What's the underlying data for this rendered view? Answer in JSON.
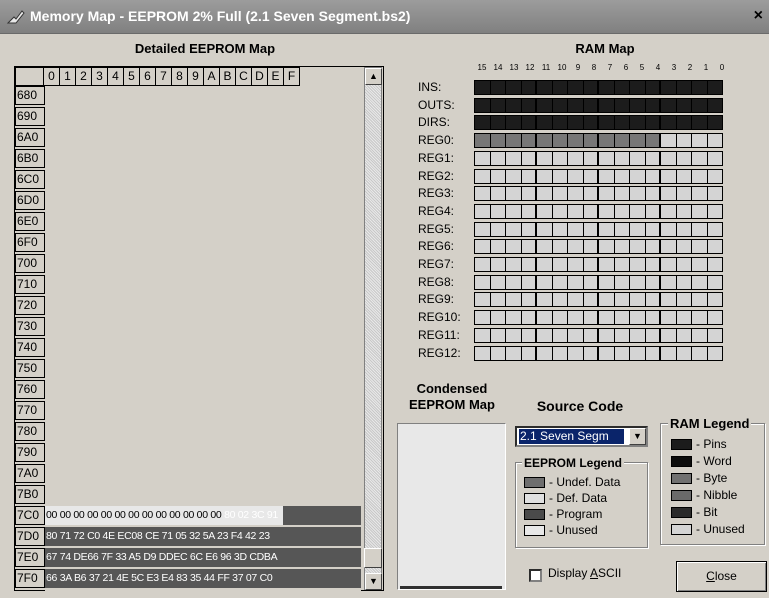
{
  "window": {
    "title": "Memory Map - EEPROM 2% Full (2.1 Seven Segment.bs2)",
    "close_glyph": "×"
  },
  "eeprom": {
    "heading": "Detailed EEPROM Map",
    "col_headers": [
      "0",
      "1",
      "2",
      "3",
      "4",
      "5",
      "6",
      "7",
      "8",
      "9",
      "A",
      "B",
      "C",
      "D",
      "E",
      "F"
    ],
    "row_headers": [
      "680",
      "690",
      "6A0",
      "6B0",
      "6C0",
      "6D0",
      "6E0",
      "6F0",
      "700",
      "710",
      "720",
      "730",
      "740",
      "750",
      "760",
      "770",
      "780",
      "790",
      "7A0",
      "7B0",
      "7C0",
      "7D0",
      "7E0",
      "7F0"
    ],
    "data_rows": [
      {
        "addr": "7C0",
        "text_light": "00 00 00 00 00 00 00 00 00 00 00 00 00 ",
        "text_dark": "80 02 3C 91"
      },
      {
        "addr": "7D0",
        "text_light": "",
        "text_dark": "80 71 72 C0 4E EC08 CE 71 05 32 5A 23 F4 42 23"
      },
      {
        "addr": "7E0",
        "text_light": "",
        "text_dark": "67 74 DE66 7F 33 A5 D9 DDEC 6C E6 96 3D CDBA"
      },
      {
        "addr": "7F0",
        "text_light": "",
        "text_dark": "66 3A B6 37 21 4E 5C E3 E4 83 35 44 FF 37 07 C0"
      }
    ]
  },
  "ram": {
    "heading": "RAM Map",
    "bit_numbers": [
      "15",
      "14",
      "13",
      "12",
      "11",
      "10",
      "9",
      "8",
      "7",
      "6",
      "5",
      "4",
      "3",
      "2",
      "1",
      "0"
    ],
    "registers": [
      {
        "label": "INS:",
        "type": "pins"
      },
      {
        "label": "OUTS:",
        "type": "pins"
      },
      {
        "label": "DIRS:",
        "type": "pins"
      },
      {
        "label": "REG0:",
        "type": "reg0"
      },
      {
        "label": "REG1:",
        "type": "unused"
      },
      {
        "label": "REG2:",
        "type": "unused"
      },
      {
        "label": "REG3:",
        "type": "unused"
      },
      {
        "label": "REG4:",
        "type": "unused"
      },
      {
        "label": "REG5:",
        "type": "unused"
      },
      {
        "label": "REG6:",
        "type": "unused"
      },
      {
        "label": "REG7:",
        "type": "unused"
      },
      {
        "label": "REG8:",
        "type": "unused"
      },
      {
        "label": "REG9:",
        "type": "unused"
      },
      {
        "label": "REG10:",
        "type": "unused"
      },
      {
        "label": "REG11:",
        "type": "unused"
      },
      {
        "label": "REG12:",
        "type": "unused"
      }
    ]
  },
  "condensed": {
    "heading_line1": "Condensed",
    "heading_line2": "EEPROM Map"
  },
  "source_code": {
    "heading": "Source Code",
    "selected": "2.1 Seven Segm"
  },
  "eeprom_legend": {
    "title": "EEPROM Legend",
    "items": [
      {
        "label": "- Undef. Data",
        "color": "#6e6e6e"
      },
      {
        "label": "- Def. Data",
        "color": "#e0e0e0"
      },
      {
        "label": "- Program",
        "color": "#4a4a4a"
      },
      {
        "label": "- Unused",
        "color": "#e8e8e8"
      }
    ]
  },
  "ram_legend": {
    "title": "RAM Legend",
    "items": [
      {
        "label": "- Pins",
        "color": "#1c1c1c"
      },
      {
        "label": "- Word",
        "color": "#0c0c0c"
      },
      {
        "label": "- Byte",
        "color": "#707070"
      },
      {
        "label": "- Nibble",
        "color": "#6a6a6a"
      },
      {
        "label": "- Bit",
        "color": "#2a2a2a"
      },
      {
        "label": "- Unused",
        "color": "#d4d4d4"
      }
    ]
  },
  "display_ascii": {
    "label": "Display ASCII",
    "checked": false
  },
  "close_button": {
    "label": "Close"
  },
  "colors": {
    "pins": "#1c1c1c",
    "reg0_used": "#777777",
    "unused": "#d4d4d4",
    "data_dark": "#565656"
  }
}
